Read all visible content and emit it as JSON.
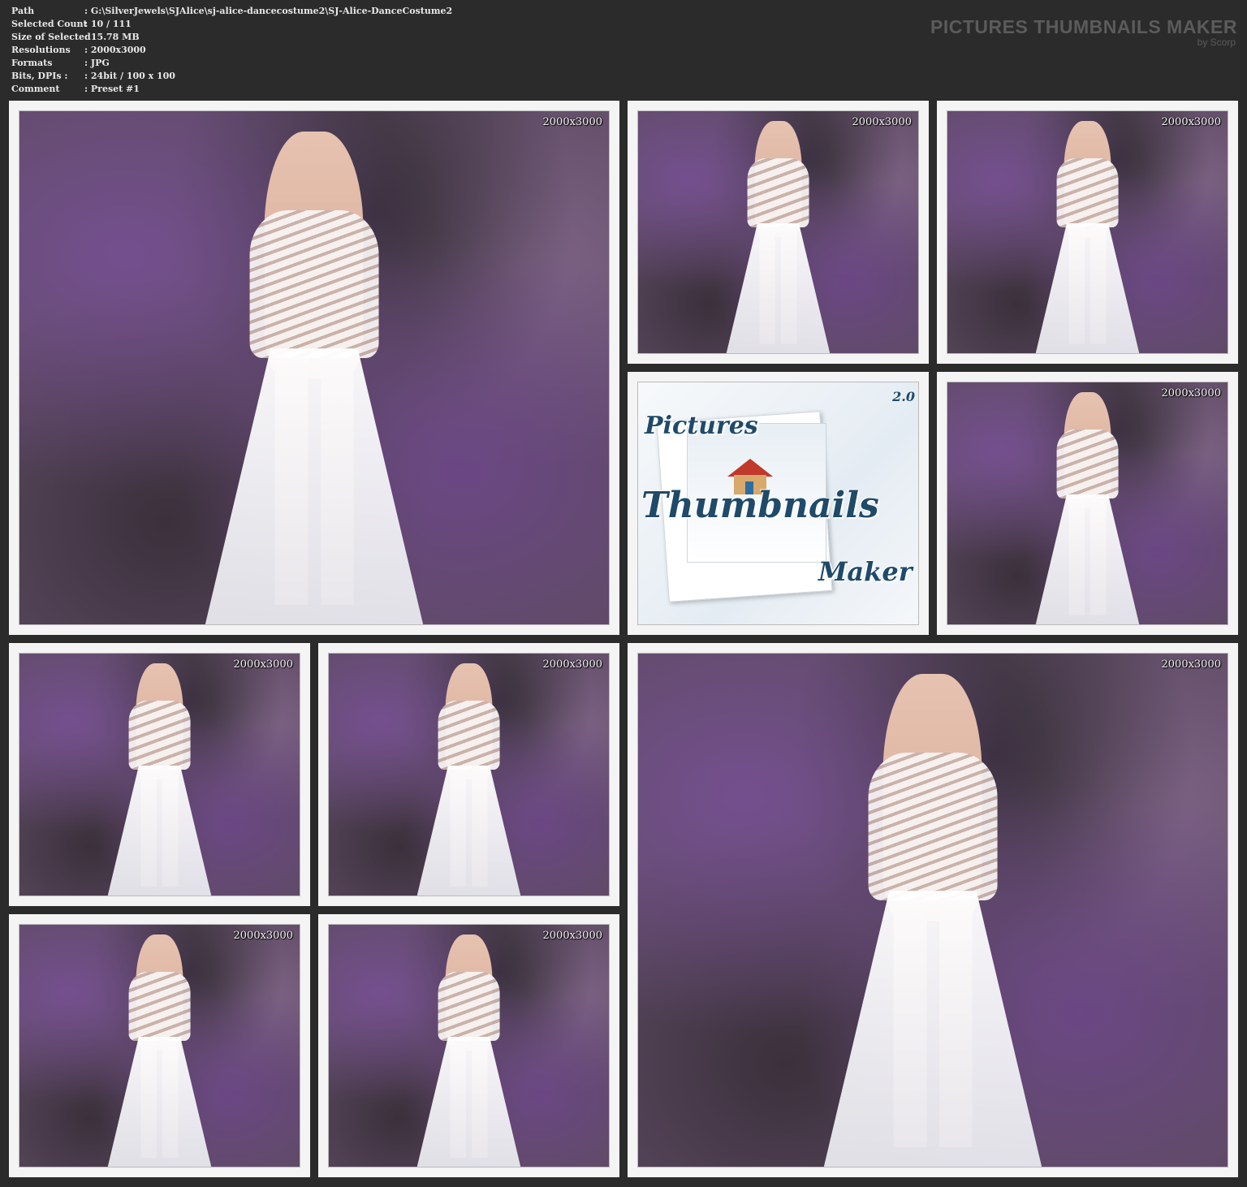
{
  "info": [
    {
      "key": "Path",
      "value": ": G:\\SilverJewels\\SJAlice\\sj-alice-dancecostume2\\SJ-Alice-DanceCostume2"
    },
    {
      "key": "Selected Count",
      "value": ": 10 / 111"
    },
    {
      "key": "Size of Selected",
      "value": ": 15.78 MB"
    },
    {
      "key": "Resolutions",
      "value": ": 2000x3000"
    },
    {
      "key": "Formats",
      "value": ": JPG"
    },
    {
      "key": "Bits, DPIs :",
      "value": ": 24bit / 100 x 100"
    },
    {
      "key": "Comment",
      "value": ": Preset #1"
    }
  ],
  "brand": {
    "title": "PICTURES THUMBNAILS MAKER",
    "subtitle": "by Scorp"
  },
  "thumb_resolution": "2000x3000",
  "logo": {
    "line1": "Pictures",
    "line2": "Thumbnails",
    "line3": "Maker",
    "version": "2.0"
  }
}
